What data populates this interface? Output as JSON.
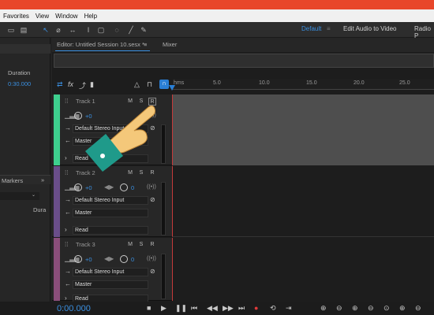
{
  "menu": [
    "Favorites",
    "View",
    "Window",
    "Help"
  ],
  "workspaces": {
    "default": "Default",
    "edit_audio_to_video": "Edit Audio to Video",
    "radio": "Radio P"
  },
  "left_panel": {
    "duration_header": "Duration",
    "duration_value": "0:30.000",
    "markers_tab": "Markers",
    "dura_col": "Dura"
  },
  "editor": {
    "tab_label": "Editor: Untitled Session 10.sesx *",
    "mixer_tab": "Mixer"
  },
  "ruler": {
    "unit": "hms",
    "ticks": [
      "5.0",
      "10.0",
      "15.0",
      "20.0",
      "25.0"
    ]
  },
  "tracks": [
    {
      "name": "Track 1",
      "volume": "+0",
      "pan": "0",
      "input": "Default Stereo Input",
      "output": "Master",
      "mode": "Read",
      "color": "#3ecf8e"
    },
    {
      "name": "Track 2",
      "volume": "+0",
      "pan": "0",
      "input": "Default Stereo Input",
      "output": "Master",
      "mode": "Read",
      "color": "#6a4e8a"
    },
    {
      "name": "Track 3",
      "volume": "+0",
      "pan": "0",
      "input": "Default Stereo Input",
      "output": "Master",
      "mode": "Read",
      "color": "#8a4e7a"
    }
  ],
  "track_buttons": {
    "m": "M",
    "s": "S",
    "r": "R"
  },
  "transport": {
    "timecode": "0:00.000"
  },
  "colors": {
    "accent_blue": "#3a8fe0",
    "top_red": "#e8462a",
    "playhead_blue": "#2a7fd6"
  }
}
